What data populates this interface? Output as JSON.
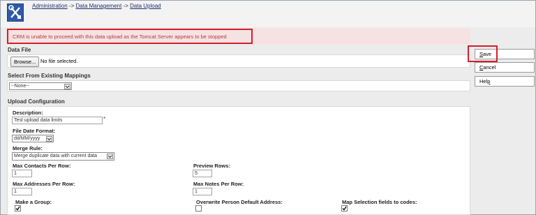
{
  "breadcrumb": {
    "items": [
      "Administration",
      "Data Management",
      "Data Upload"
    ],
    "separator": "->"
  },
  "error": {
    "message": "CRM is unable to proceed with this data upload as the Tomcat Server appears to be stopped"
  },
  "data_file": {
    "title": "Data File",
    "browse_label": "Browse...",
    "file_status": "No file selected."
  },
  "mappings": {
    "title": "Select From Existing Mappings",
    "selected": "--None--"
  },
  "upload": {
    "title": "Upload Configuration",
    "description_label": "Description:",
    "description_value": "Test upload data limits",
    "required_mark": "*",
    "file_date_format_label": "File Date Format:",
    "file_date_format_value": "dd/MM/yyyy",
    "merge_rule_label": "Merge Rule:",
    "merge_rule_value": "Merge duplicate data with current data",
    "max_contacts_label": "Max Contacts Per Row:",
    "max_contacts_value": "1",
    "preview_rows_label": "Preview Rows:",
    "preview_rows_value": "5",
    "max_addresses_label": "Max Addresses Per Row:",
    "max_addresses_value": "1",
    "max_notes_label": "Max Notes Per Row:",
    "max_notes_value": "1",
    "make_group_label": "Make a Group:",
    "make_group_checked": true,
    "overwrite_label": "Overwrite Person Default Address:",
    "overwrite_checked": false,
    "map_selection_label": "Map Selection fields to codes:",
    "map_selection_checked": true
  },
  "actions": {
    "save": {
      "pre": "",
      "key": "S",
      "post": "ave"
    },
    "cancel": {
      "pre": "",
      "key": "C",
      "post": "ancel"
    },
    "help": {
      "pre": "Hel",
      "key": "p",
      "post": ""
    }
  },
  "colors": {
    "error_border": "#d21f2a",
    "error_text": "#b53a3a",
    "error_background": "#f6e2e2",
    "required_mark": "#1a3cc8",
    "logo_background": "#2e5aa8"
  }
}
